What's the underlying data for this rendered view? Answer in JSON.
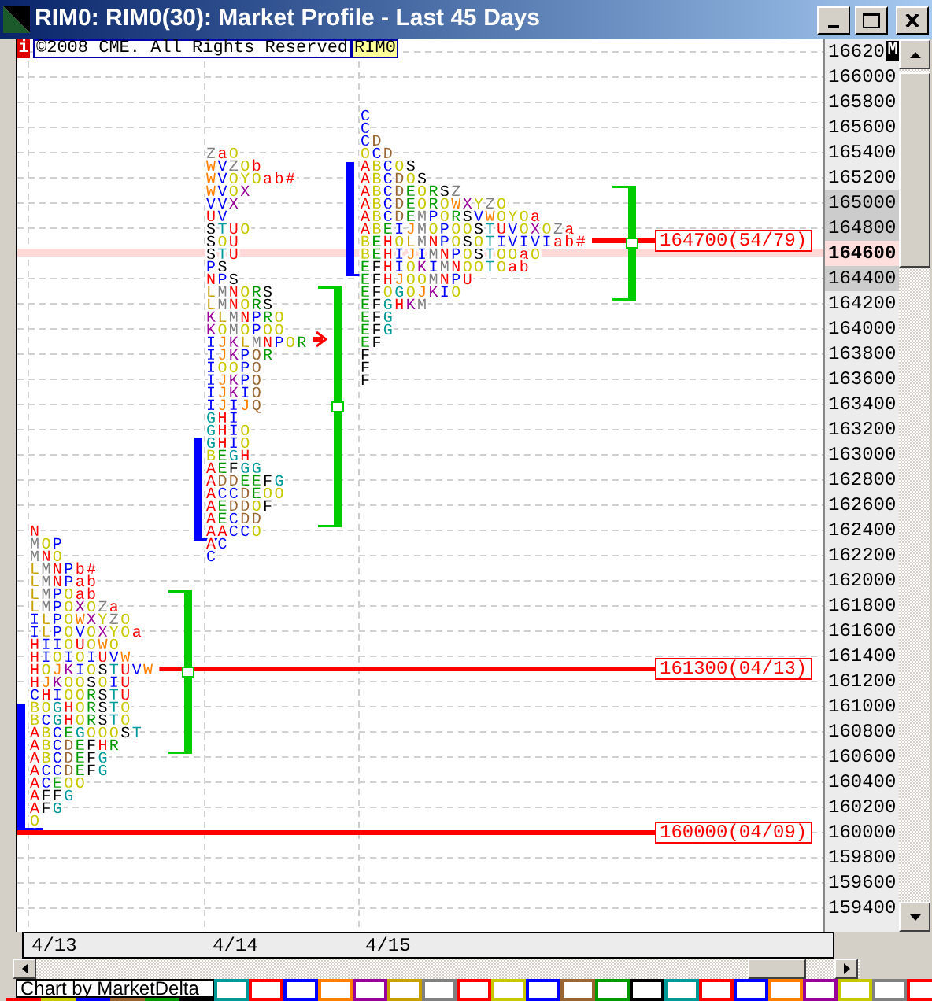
{
  "window": {
    "title": "RIM0: RIM0(30): Market Profile - Last 45 Days"
  },
  "info": {
    "icon_text": "i",
    "copyright": "©2008 CME. All Rights Reserved",
    "symbol": "RIM0"
  },
  "axis_badge": "M",
  "prices": [
    {
      "text": "16620",
      "current": false,
      "band": false
    },
    {
      "text": "166000",
      "current": false,
      "band": false
    },
    {
      "text": "165800",
      "current": false,
      "band": false
    },
    {
      "text": "165600",
      "current": false,
      "band": false
    },
    {
      "text": "165400",
      "current": false,
      "band": false
    },
    {
      "text": "165200",
      "current": false,
      "band": false
    },
    {
      "text": "165000",
      "current": false,
      "band": true
    },
    {
      "text": "164800",
      "current": false,
      "band": true
    },
    {
      "text": "164600",
      "current": true,
      "band": false
    },
    {
      "text": "164400",
      "current": false,
      "band": true
    },
    {
      "text": "164200",
      "current": false,
      "band": false
    },
    {
      "text": "164000",
      "current": false,
      "band": false
    },
    {
      "text": "163800",
      "current": false,
      "band": false
    },
    {
      "text": "163600",
      "current": false,
      "band": false
    },
    {
      "text": "163400",
      "current": false,
      "band": false
    },
    {
      "text": "163200",
      "current": false,
      "band": false
    },
    {
      "text": "163000",
      "current": false,
      "band": false
    },
    {
      "text": "162800",
      "current": false,
      "band": false
    },
    {
      "text": "162600",
      "current": false,
      "band": false
    },
    {
      "text": "162400",
      "current": false,
      "band": false
    },
    {
      "text": "162200",
      "current": false,
      "band": false
    },
    {
      "text": "162000",
      "current": false,
      "band": false
    },
    {
      "text": "161800",
      "current": false,
      "band": false
    },
    {
      "text": "161600",
      "current": false,
      "band": false
    },
    {
      "text": "161400",
      "current": false,
      "band": false
    },
    {
      "text": "161200",
      "current": false,
      "band": false
    },
    {
      "text": "161000",
      "current": false,
      "band": false
    },
    {
      "text": "160800",
      "current": false,
      "band": false
    },
    {
      "text": "160600",
      "current": false,
      "band": false
    },
    {
      "text": "160400",
      "current": false,
      "band": false
    },
    {
      "text": "160200",
      "current": false,
      "band": false
    },
    {
      "text": "160000",
      "current": false,
      "band": false
    },
    {
      "text": "159800",
      "current": false,
      "band": false
    },
    {
      "text": "159600",
      "current": false,
      "band": false
    },
    {
      "text": "159400",
      "current": false,
      "band": false
    }
  ],
  "profiles": [
    {
      "date": "4/13",
      "rows": [
        "N",
        "MOP",
        "MNO",
        "LMNPb#",
        "LMNPab",
        "LMPOab",
        "LMPOXOZa",
        "ILPOWXYZO",
        "ILPOVOXYOa",
        "HIIOUOWO",
        "HIOIOIUVW",
        "HOJKIOSTUVW",
        "HJKOOSOIU",
        "CHIOORSTU",
        "BOGHORSTO",
        "BCGHORSTO",
        "ABCEGOOOST",
        "ABCDEFHR",
        "ABCDEFG",
        "ACCDEFG",
        "ACEOO",
        "AFFG",
        "AFG",
        "O"
      ]
    },
    {
      "date": "4/14",
      "rows": [
        "ZaO",
        "WVZOb",
        "WVOYOab#",
        "WVOX",
        "VVX",
        "UV",
        "STUO",
        "SOU",
        "STU",
        "PS",
        "NPS",
        "LMNORS",
        "LMNORS",
        "KLMNPRO",
        "KOMOPOO",
        "IJKLMNPOR",
        "IJKPQR",
        "IOOPQ",
        "IJKPQ",
        "IJKIQ",
        "IJIJQ",
        "GHI",
        "GHIO",
        "GHIO",
        "BEGH",
        "AEFGG",
        "ADDEEFG",
        "ACCDEOO",
        "AEDDOF",
        "AECDD",
        "AACCO",
        "AC",
        "C"
      ]
    },
    {
      "date": "4/15",
      "rows": [
        "C",
        "C",
        "CD",
        "OCD",
        "ABCOS",
        "ABCDOS",
        "ABCDEORSZ",
        "ABCDEOROWXYZO",
        "ABCDEMPORSVWOYOa",
        "ABEIJMOPOOSTUVOXOZa",
        "BEHOLMNPOSOTIVIVIab#",
        "BEHIJIMNPOSTOOaO",
        "EFHIOKIMNOOTOab",
        "EFHJOOMNPU",
        "EFOGOJKIO",
        "EFGHKM",
        "EFG",
        "EFG",
        "EF",
        "F",
        "F",
        "F"
      ]
    }
  ],
  "levels": [
    {
      "label": "164700(54/79)"
    },
    {
      "label": "161300(04/13)"
    },
    {
      "label": "160000(04/09)"
    }
  ],
  "legend": {
    "text": "Chart by MarketDelta",
    "swatches": [
      {
        "color": "#ff0000"
      },
      {
        "color": "#c8c800"
      },
      {
        "color": "#0000ff"
      },
      {
        "color": "#996633"
      },
      {
        "color": "#009900"
      },
      {
        "color": "#000000"
      },
      {
        "color": "#009999"
      },
      {
        "color": "#ff0000"
      },
      {
        "color": "#0000ff"
      },
      {
        "color": "#ff8000"
      },
      {
        "color": "#990099"
      },
      {
        "color": "#c8a000"
      },
      {
        "color": "#808080"
      },
      {
        "color": "#ff0000"
      },
      {
        "color": "#c8c800"
      },
      {
        "color": "#0000ff"
      },
      {
        "color": "#996633"
      },
      {
        "color": "#009900"
      },
      {
        "color": "#000000"
      },
      {
        "color": "#009999"
      },
      {
        "color": "#ff0000"
      },
      {
        "color": "#0000ff"
      },
      {
        "color": "#ff8000"
      },
      {
        "color": "#990099"
      },
      {
        "color": "#c8c800"
      },
      {
        "color": "#808080"
      },
      {
        "color": "#ff0000"
      }
    ]
  }
}
